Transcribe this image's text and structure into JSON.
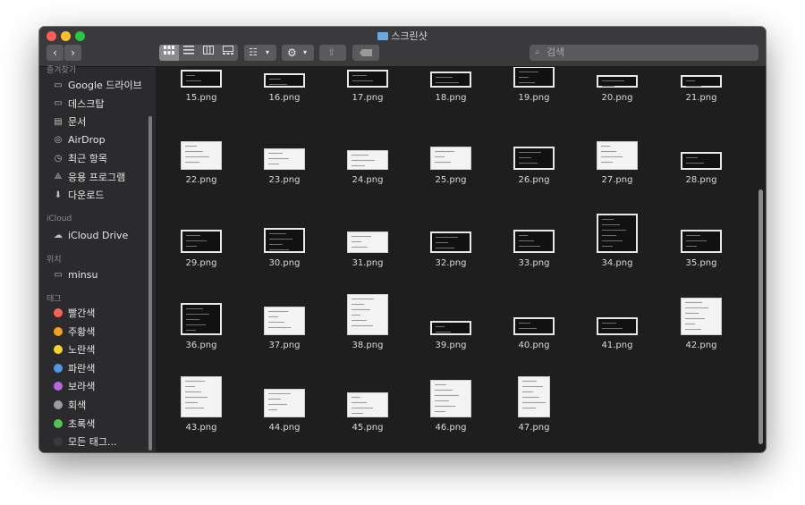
{
  "window": {
    "title": "스크린샷"
  },
  "toolbar": {
    "back_glyph": "‹",
    "forward_glyph": "›",
    "view_icon": "☷",
    "action_icon": "⚙",
    "share_icon": "⇪",
    "tag_icon": "tag-icon",
    "search_placeholder": "검색"
  },
  "sidebar": {
    "favorites_header": "즐겨찾기",
    "favorites": [
      {
        "label": "Google 드라이브",
        "icon": "folder-icon"
      },
      {
        "label": "데스크탑",
        "icon": "desktop-icon"
      },
      {
        "label": "문서",
        "icon": "document-icon"
      },
      {
        "label": "AirDrop",
        "icon": "airdrop-icon"
      },
      {
        "label": "최근 항목",
        "icon": "clock-icon"
      },
      {
        "label": "응용 프로그램",
        "icon": "applications-icon"
      },
      {
        "label": "다운로드",
        "icon": "download-icon"
      }
    ],
    "icloud_header": "iCloud",
    "icloud": [
      {
        "label": "iCloud Drive",
        "icon": "cloud-icon"
      }
    ],
    "locations_header": "위치",
    "locations": [
      {
        "label": "minsu",
        "icon": "computer-icon"
      }
    ],
    "tags_header": "태그",
    "tags": [
      {
        "label": "빨간색",
        "color": "#fe5f57"
      },
      {
        "label": "주황색",
        "color": "#f59e24"
      },
      {
        "label": "노란색",
        "color": "#f7d230"
      },
      {
        "label": "파란색",
        "color": "#4f9ae6"
      },
      {
        "label": "보라색",
        "color": "#b967e0"
      },
      {
        "label": "회색",
        "color": "#9c9c9e"
      },
      {
        "label": "초록색",
        "color": "#52c44f"
      },
      {
        "label": "모든 태그...",
        "color": "#3a3a3c"
      }
    ]
  },
  "files": [
    {
      "name": "15.png",
      "style": "dark"
    },
    {
      "name": "16.png",
      "style": "dark"
    },
    {
      "name": "17.png",
      "style": "dark"
    },
    {
      "name": "18.png",
      "style": "dark"
    },
    {
      "name": "19.png",
      "style": "dark"
    },
    {
      "name": "20.png",
      "style": "dark"
    },
    {
      "name": "21.png",
      "style": "dark"
    },
    {
      "name": "22.png",
      "style": "light"
    },
    {
      "name": "23.png",
      "style": "light"
    },
    {
      "name": "24.png",
      "style": "light"
    },
    {
      "name": "25.png",
      "style": "light"
    },
    {
      "name": "26.png",
      "style": "dark"
    },
    {
      "name": "27.png",
      "style": "light"
    },
    {
      "name": "28.png",
      "style": "dark"
    },
    {
      "name": "29.png",
      "style": "dark"
    },
    {
      "name": "30.png",
      "style": "dark"
    },
    {
      "name": "31.png",
      "style": "light"
    },
    {
      "name": "32.png",
      "style": "dark"
    },
    {
      "name": "33.png",
      "style": "dark"
    },
    {
      "name": "34.png",
      "style": "dark"
    },
    {
      "name": "35.png",
      "style": "dark"
    },
    {
      "name": "36.png",
      "style": "dark"
    },
    {
      "name": "37.png",
      "style": "light"
    },
    {
      "name": "38.png",
      "style": "light"
    },
    {
      "name": "39.png",
      "style": "dark"
    },
    {
      "name": "40.png",
      "style": "dark"
    },
    {
      "name": "41.png",
      "style": "dark"
    },
    {
      "name": "42.png",
      "style": "light"
    },
    {
      "name": "43.png",
      "style": "light"
    },
    {
      "name": "44.png",
      "style": "light"
    },
    {
      "name": "45.png",
      "style": "light"
    },
    {
      "name": "46.png",
      "style": "light"
    },
    {
      "name": "47.png",
      "style": "light"
    }
  ]
}
